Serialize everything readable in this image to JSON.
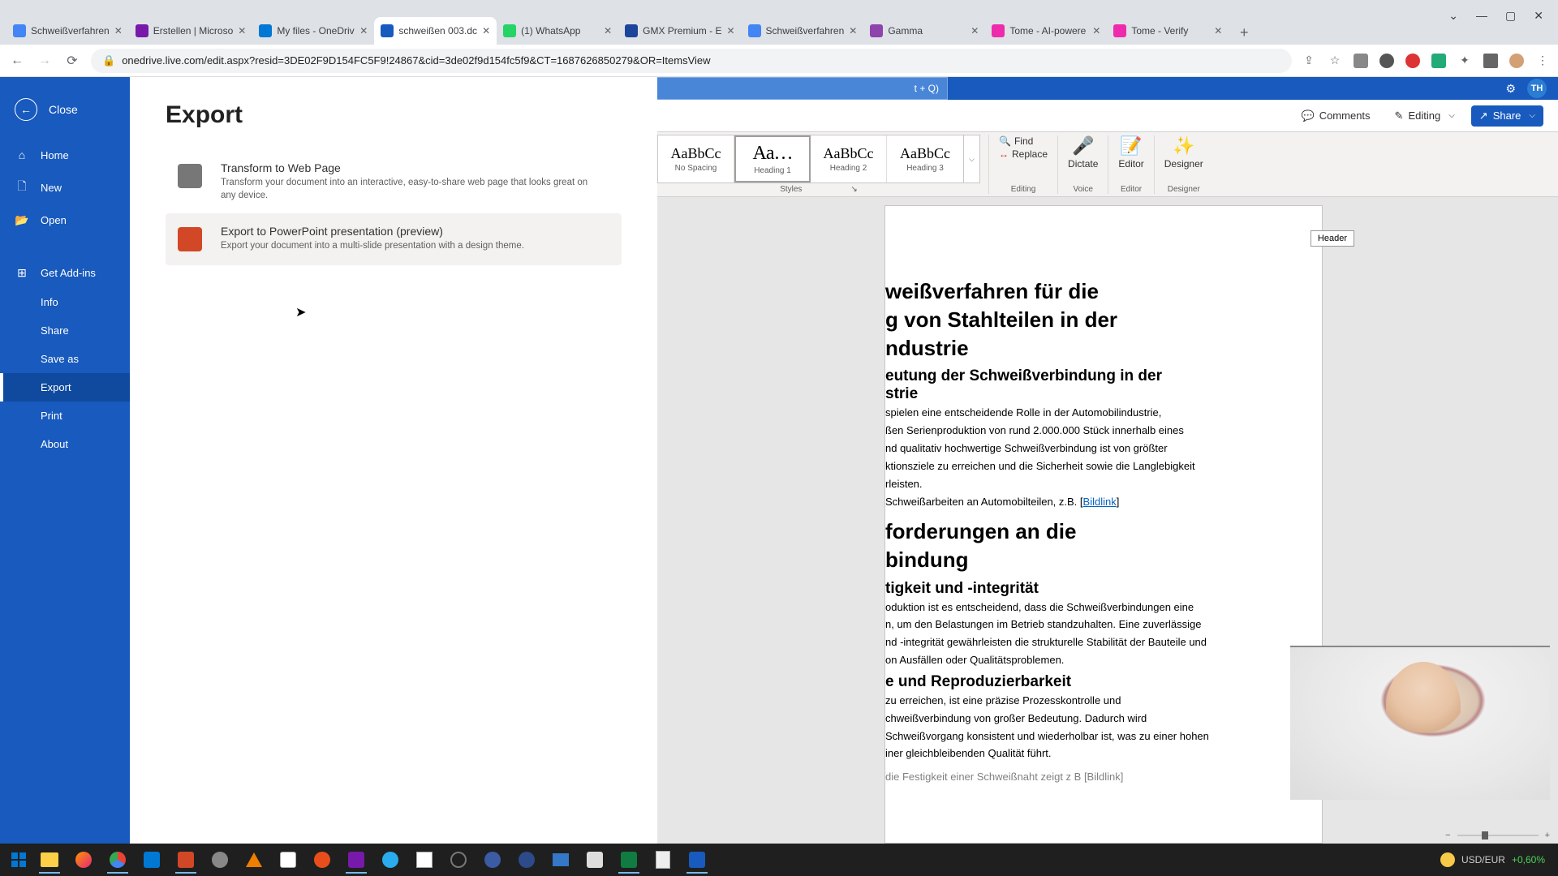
{
  "browser": {
    "tabs": [
      {
        "title": "Schweißverfahren",
        "fav": "#4285f4"
      },
      {
        "title": "Erstellen | Microso",
        "fav": "#7719aa"
      },
      {
        "title": "My files - OneDriv",
        "fav": "#0078d4"
      },
      {
        "title": "schweißen 003.dc",
        "fav": "#185abd",
        "active": true
      },
      {
        "title": "(1) WhatsApp",
        "fav": "#25d366"
      },
      {
        "title": "GMX Premium - E",
        "fav": "#1c449b"
      },
      {
        "title": "Schweißverfahren",
        "fav": "#4285f4"
      },
      {
        "title": "Gamma",
        "fav": "#8e44ad"
      },
      {
        "title": "Tome - AI-powere",
        "fav": "#ed2bac"
      },
      {
        "title": "Tome - Verify",
        "fav": "#ed2bac"
      }
    ],
    "newtab": "+",
    "win_down": "⌄",
    "win_min": "—",
    "win_max": "▢",
    "win_close": "✕",
    "url": "onedrive.live.com/edit.aspx?resid=3DE02F9D154FC5F9!24867&cid=3de02f9d154fc5f9&CT=1687626850279&OR=ItemsView"
  },
  "word": {
    "user_initials": "TH",
    "search_hint": "t + Q)",
    "cmd": {
      "comments": "Comments",
      "editing": "Editing",
      "share": "Share"
    },
    "styles": [
      {
        "sample": "AaBbCc",
        "label": "No Spacing"
      },
      {
        "sample": "Aa…",
        "label": "Heading 1",
        "sel": true
      },
      {
        "sample": "AaBbCc",
        "label": "Heading 2"
      },
      {
        "sample": "AaBbCc",
        "label": "Heading 3"
      }
    ],
    "groups": {
      "styles": "Styles",
      "editing": "Editing",
      "voice": "Voice",
      "editor": "Editor",
      "designer": "Designer",
      "find": "Find",
      "replace": "Replace",
      "dictate": "Dictate",
      "editor_btn": "Editor",
      "designer_btn": "Designer"
    },
    "header_chip": "Header",
    "zoom_minus": "−",
    "zoom_plus": "+"
  },
  "backstage": {
    "close": "Close",
    "nav": [
      {
        "icon": "⌂",
        "label": "Home"
      },
      {
        "icon": "🗋",
        "label": "New"
      },
      {
        "icon": "📂",
        "label": "Open"
      },
      {
        "icon": "⊞",
        "label": "Get Add-ins"
      },
      {
        "icon": "",
        "label": "Info"
      },
      {
        "icon": "",
        "label": "Share"
      },
      {
        "icon": "",
        "label": "Save as"
      },
      {
        "icon": "",
        "label": "Export",
        "sel": true
      },
      {
        "icon": "",
        "label": "Print"
      },
      {
        "icon": "",
        "label": "About"
      }
    ],
    "title": "Export",
    "items": [
      {
        "title": "Transform to Web Page",
        "desc": "Transform your document into an interactive, easy-to-share web page that looks great on any device.",
        "icon_bg": "#777"
      },
      {
        "title": "Export to PowerPoint presentation (preview)",
        "desc": "Export your document into a multi-slide presentation with a design theme.",
        "icon_bg": "#d24726",
        "hover": true
      }
    ]
  },
  "document": {
    "h1a": "weißverfahren für die",
    "h1b": "g von Stahlteilen in der",
    "h1c": "ndustrie",
    "h2a": "eutung der Schweißverbindung in der",
    "h2b": "strie",
    "p1": "spielen eine entscheidende Rolle in der Automobilindustrie,",
    "p2": "ßen Serienproduktion von rund 2.000.000 Stück innerhalb eines",
    "p3": "nd qualitativ hochwertige Schweißverbindung ist von größter",
    "p4": "ktionsziele zu erreichen und die Sicherheit sowie die Langlebigkeit",
    "p5": "rleisten.",
    "p6a": "Schweißarbeiten an Automobilteilen, z.B. [",
    "p6link": "Bildlink",
    "p6b": "]",
    "h2c": "forderungen an die",
    "h2d": "bindung",
    "h3a": "tigkeit und -integrität",
    "p7": "oduktion ist es entscheidend, dass die Schweißverbindungen eine",
    "p8": "n, um den Belastungen im Betrieb standzuhalten. Eine zuverlässige",
    "p9": "nd -integrität gewährleisten die strukturelle Stabilität der Bauteile und",
    "p10": "on Ausfällen oder Qualitätsproblemen.",
    "h3b": "e und Reproduzierbarkeit",
    "p11": "zu erreichen, ist eine präzise Prozesskontrolle und",
    "p12": "chweißverbindung von großer Bedeutung. Dadurch wird",
    "p13": "Schweißvorgang konsistent und wiederholbar ist, was zu einer hohen",
    "p14": "iner gleichbleibenden Qualität führt.",
    "p15": "die Festigkeit einer Schweißnaht zeigt  z B  [Bildlink]"
  },
  "taskbar": {
    "ticker_pair": "USD/EUR",
    "ticker_change": "+0,60%"
  }
}
